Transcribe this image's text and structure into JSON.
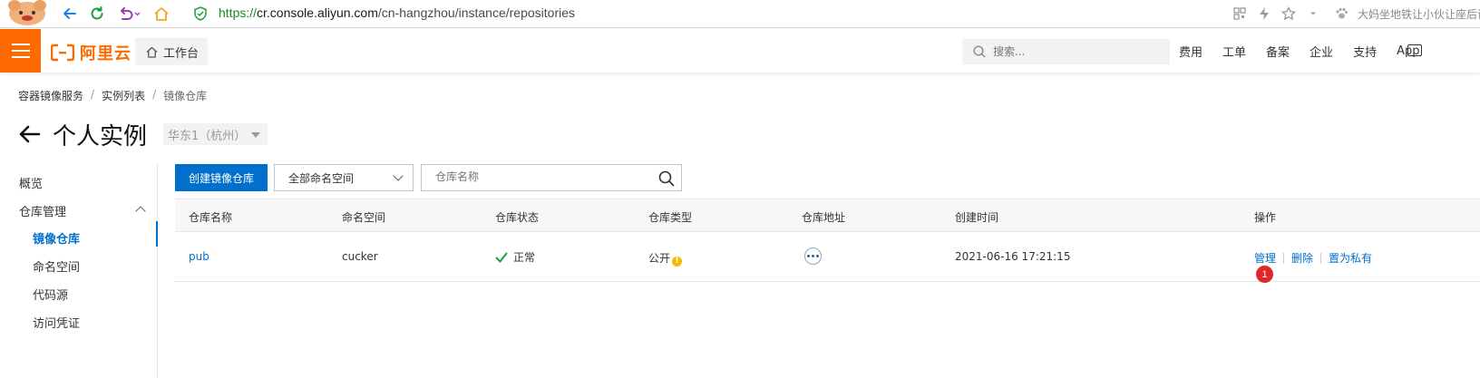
{
  "browser": {
    "url_scheme": "https://",
    "url_host": "cr.console.aliyun.com",
    "url_path": "/cn-hangzhou/instance/repositories",
    "news_text": "大妈坐地铁让小伙让座后训话"
  },
  "header": {
    "logo_text": "阿里云",
    "workbench_label": "工作台",
    "search_placeholder": "搜索...",
    "nav_items": [
      "费用",
      "工单",
      "备案",
      "企业",
      "支持",
      "App"
    ],
    "accent_color": "#ff6a00"
  },
  "breadcrumb": [
    "容器镜像服务",
    "实例列表",
    "镜像仓库"
  ],
  "page": {
    "title": "个人实例",
    "region": "华东1（杭州）"
  },
  "sidebar": {
    "items": [
      {
        "label": "概览"
      },
      {
        "label": "仓库管理"
      },
      {
        "label": "镜像仓库"
      },
      {
        "label": "命名空间"
      },
      {
        "label": "代码源"
      },
      {
        "label": "访问凭证"
      }
    ],
    "active_index": 2
  },
  "toolbar": {
    "create_button": "创建镜像仓库",
    "namespace_select": "全部命名空间",
    "search_placeholder": "仓库名称"
  },
  "table": {
    "columns": [
      "仓库名称",
      "命名空间",
      "仓库状态",
      "仓库类型",
      "仓库地址",
      "创建时间",
      "操作"
    ],
    "rows": [
      {
        "name": "pub",
        "namespace": "cucker",
        "status": "正常",
        "type": "公开",
        "created": "2021-06-16 17:21:15",
        "actions": [
          "管理",
          "删除",
          "置为私有"
        ]
      }
    ]
  },
  "annotation_badge": "1",
  "colors": {
    "primary": "#0070cc",
    "success": "#1e9e3a",
    "warning": "#f5b800",
    "badge": "#e0262b"
  }
}
